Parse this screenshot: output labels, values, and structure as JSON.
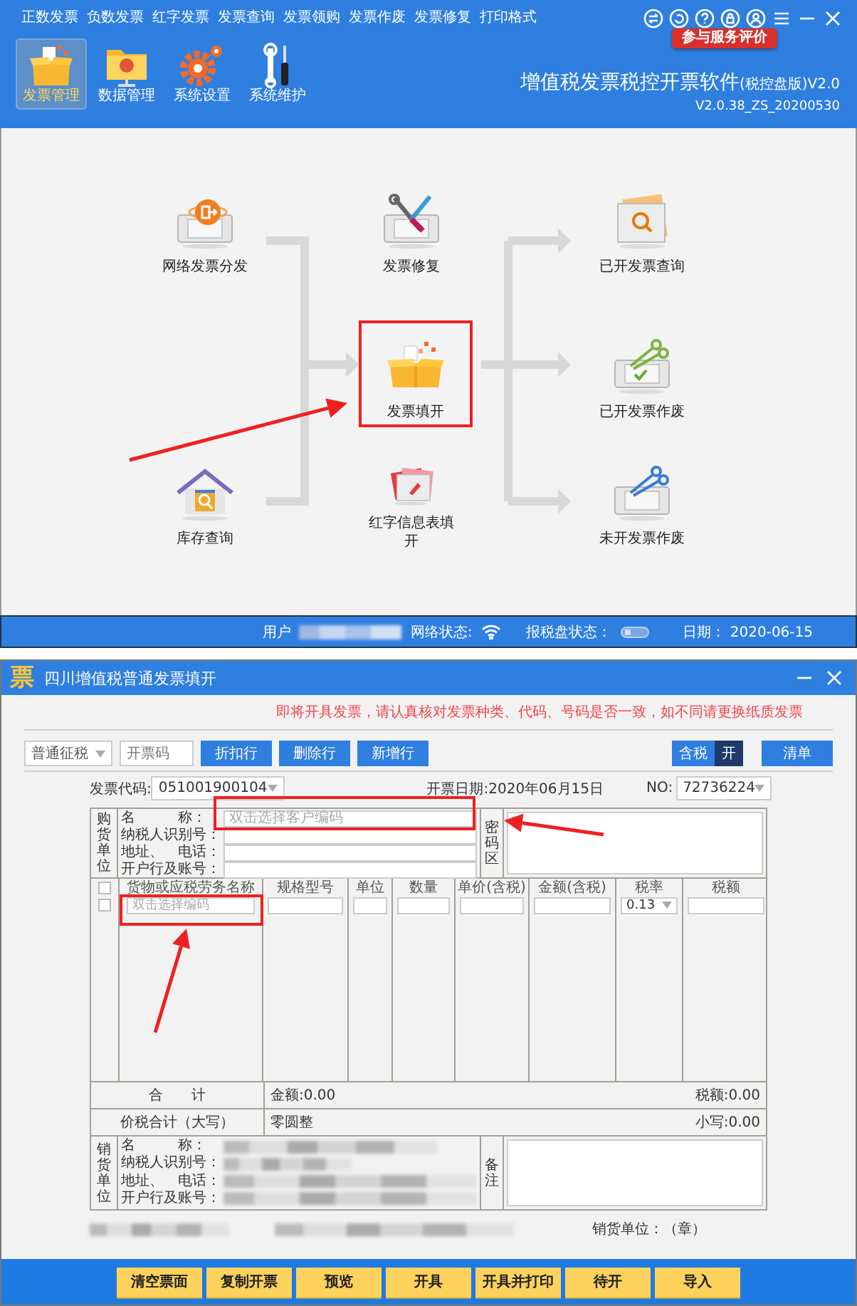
{
  "main_window": {
    "menu": [
      "正数发票",
      "负数发票",
      "红字发票",
      "发票查询",
      "发票领购",
      "发票作废",
      "发票修复",
      "打印格式"
    ],
    "service_badge": "参与服务评价",
    "toolbar": [
      {
        "label": "发票管理",
        "selected": true
      },
      {
        "label": "数据管理",
        "selected": false
      },
      {
        "label": "系统设置",
        "selected": false
      },
      {
        "label": "系统维护",
        "selected": false
      }
    ],
    "app_title": "增值税发票税控开票软件",
    "app_edition": "(税控盘版)V2.0",
    "version": "V2.0.38_ZS_20200530",
    "flow": [
      {
        "label": "网络发票分发",
        "highlighted": false
      },
      {
        "label": "发票修复",
        "highlighted": false
      },
      {
        "label": "已开发票查询",
        "highlighted": false
      },
      {
        "label": "发票填开",
        "highlighted": true
      },
      {
        "label": "已开发票作废",
        "highlighted": false
      },
      {
        "label": "库存查询",
        "highlighted": false
      },
      {
        "label": "红字信息表填开",
        "highlighted": false
      },
      {
        "label": "未开发票作废",
        "highlighted": false
      }
    ],
    "status_bar": {
      "user_label": "用户",
      "network_label": "网络状态:",
      "disk_label": "报税盘状态：",
      "date_label": "日期：",
      "date": "2020-06-15"
    }
  },
  "invoice_window": {
    "logo": "票",
    "title": "四川增值税普通发票填开",
    "notice": "即将开具发票，请认真核对发票种类、代码、号码是否一致，如不同请更换纸质发票",
    "tax_mode": "普通征税",
    "code_field": {
      "placeholder": "开票码"
    },
    "row_buttons": [
      "折扣行",
      "删除行",
      "新增行"
    ],
    "tax_toggle": {
      "label": "含税",
      "state": "开",
      "on": true
    },
    "list_button": "清单",
    "invoice_code_label": "发票代码:",
    "invoice_code": "051001900104",
    "date_text": "开票日期:2020年06月15日",
    "number_label": "NO:",
    "number": "72736224",
    "buyer": {
      "title": "购货单位",
      "fields": [
        {
          "label": "名　　　称：",
          "placeholder": "双击选择客户编码"
        },
        {
          "label": "纳税人识别号："
        },
        {
          "label": "地址、　电话："
        },
        {
          "label": "开户行及账号："
        }
      ],
      "cipher_label": "密码区"
    },
    "items": {
      "columns": [
        "货物或应税劳务名称",
        "规格型号",
        "单位",
        "数量",
        "单价(含税)",
        "金额(含税)",
        "税率",
        "税额"
      ],
      "select_all_checked": false,
      "rows": [
        {
          "checked": false,
          "name_placeholder": "双击选择编码",
          "tax_rate": "0.13"
        }
      ]
    },
    "totals": {
      "label": "合　　计",
      "amount": "金额:0.00",
      "tax": "税额:0.00"
    },
    "grand_total": {
      "label": "价税合计（大写）",
      "words": "零圆整",
      "small": "小写:0.00"
    },
    "seller": {
      "title": "销货单位",
      "fields": [
        "名　　　称：",
        "纳税人识别号：",
        "地址、　电话：",
        "开户行及账号："
      ],
      "remark_label": "备注"
    },
    "stamp_label": "销货单位：（章）",
    "actions": [
      "清空票面",
      "复制开票",
      "预览",
      "开具",
      "开具并打印",
      "待开",
      "导入"
    ]
  }
}
